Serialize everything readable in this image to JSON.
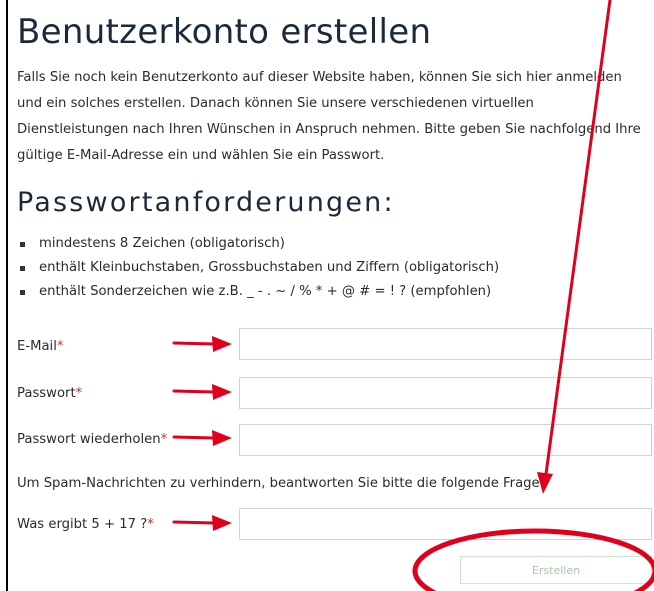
{
  "page": {
    "title": "Benutzerkonto erstellen",
    "intro": "Falls Sie noch kein Benutzerkonto auf dieser Website haben, können Sie sich hier anmelden und ein solches erstellen. Danach können Sie unsere verschiedenen virtuellen Dienstleistungen nach Ihren Wünschen in Anspruch nehmen. Bitte geben Sie nachfolgend Ihre gültige E-Mail-Adresse ein und wählen Sie ein Passwort."
  },
  "requirements": {
    "heading": "Passwortanforderungen:",
    "items": [
      "mindestens 8 Zeichen (obligatorisch)",
      "enthält Kleinbuchstaben, Grossbuchstaben und Ziffern (obligatorisch)",
      "enthält Sonderzeichen wie z.B. _ - . ~ / % * + @ # = ! ? (empfohlen)"
    ]
  },
  "form": {
    "email_label": "E-Mail",
    "email_value": "",
    "password_label": "Passwort",
    "password_value": "",
    "password_repeat_label": "Passwort wiederholen",
    "password_repeat_value": "",
    "spam_note": "Um Spam-Nachrichten zu verhindern, beantworten Sie bitte die folgende Frage:",
    "captcha_label": "Was ergibt 5 + 17 ?",
    "captcha_value": "",
    "required_marker": "*",
    "submit_label": "Erstellen"
  },
  "annotations": {
    "arrow_color": "#e0001b",
    "ellipse_color": "#e0001b"
  }
}
